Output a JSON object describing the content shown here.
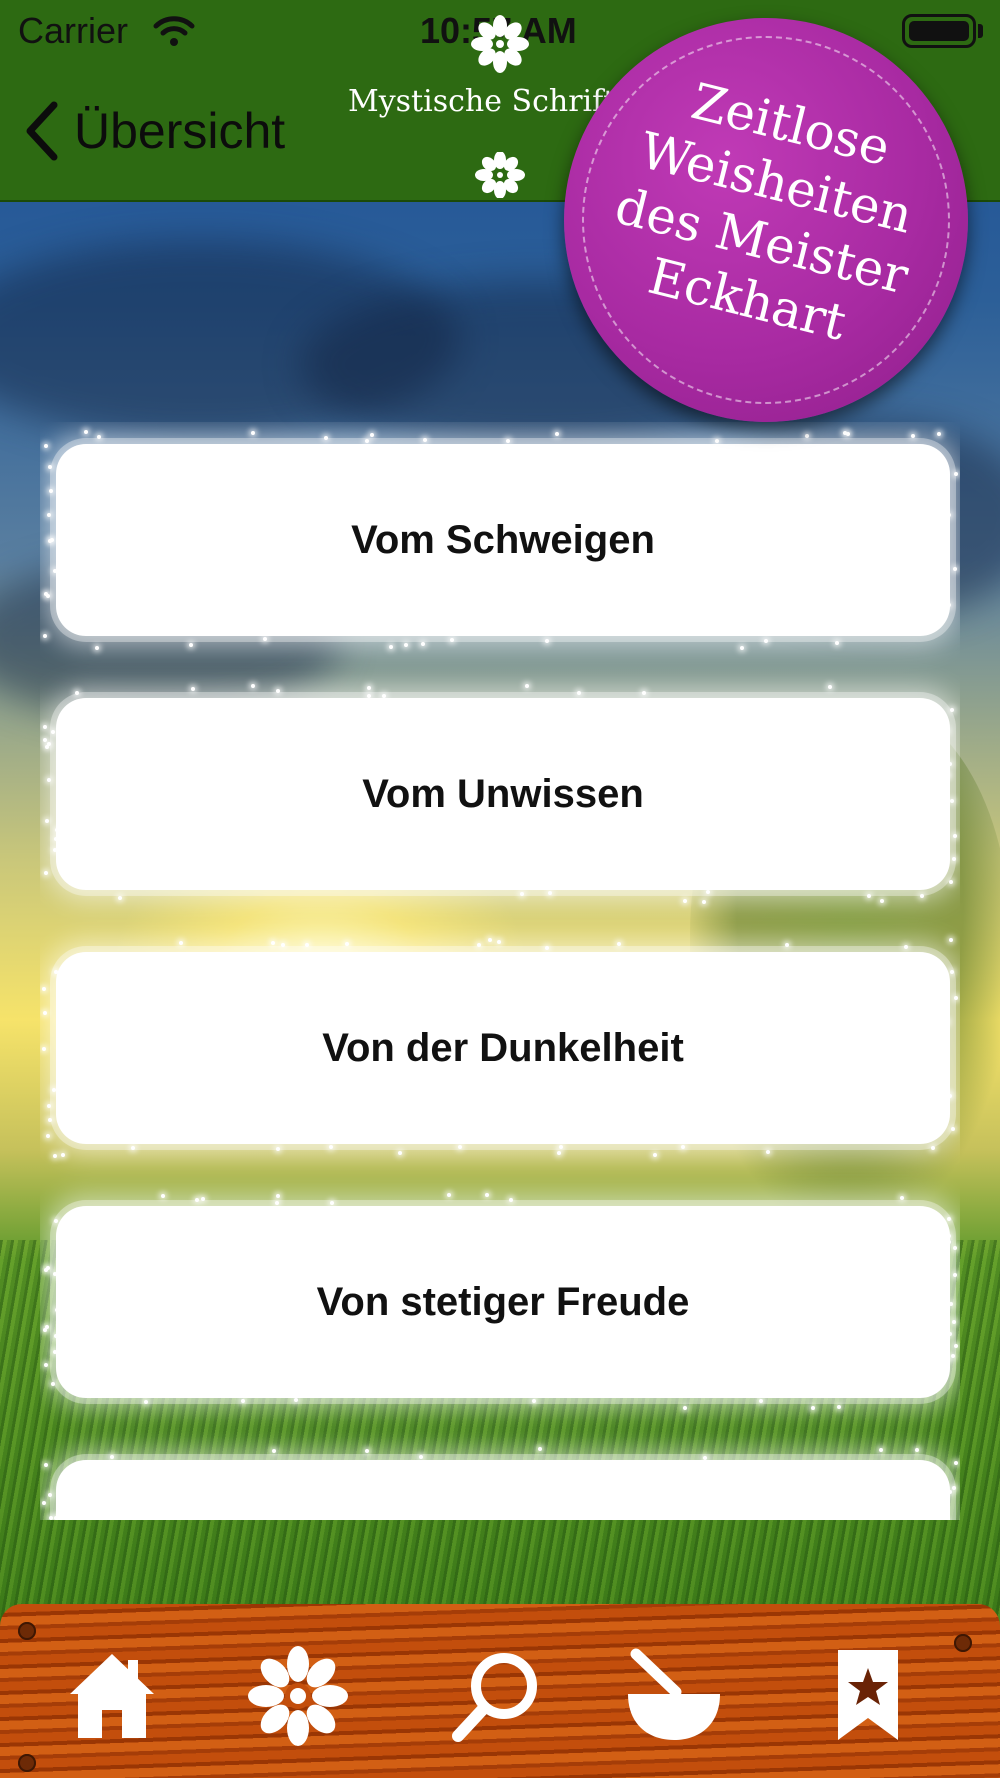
{
  "status_bar": {
    "carrier": "Carrier",
    "time": "10:57 AM",
    "wifi_icon": "wifi-icon",
    "battery_icon": "battery-icon"
  },
  "nav": {
    "back_label": "Übersicht",
    "title": "Mystische Schriften",
    "back_icon": "chevron-left-icon",
    "decor_icon": "flower-icon"
  },
  "badge": {
    "lines": [
      "Zeitlose",
      "Weisheiten",
      "des Meister",
      "Eckhart"
    ],
    "color": "#a82aa2"
  },
  "list": {
    "items": [
      {
        "label": "Vom Schweigen"
      },
      {
        "label": "Vom Unwissen"
      },
      {
        "label": "Von der Dunkelheit"
      },
      {
        "label": "Von stetiger Freude"
      },
      {
        "label": ""
      }
    ]
  },
  "tabbar": {
    "tabs": [
      {
        "icon": "home-icon"
      },
      {
        "icon": "flower-icon"
      },
      {
        "icon": "search-icon"
      },
      {
        "icon": "mortar-pestle-icon"
      },
      {
        "icon": "bookmark-star-icon"
      }
    ],
    "color": "#c34e0c"
  },
  "colors": {
    "nav_green": "#2d6a12",
    "item_background": "#ffffff"
  }
}
